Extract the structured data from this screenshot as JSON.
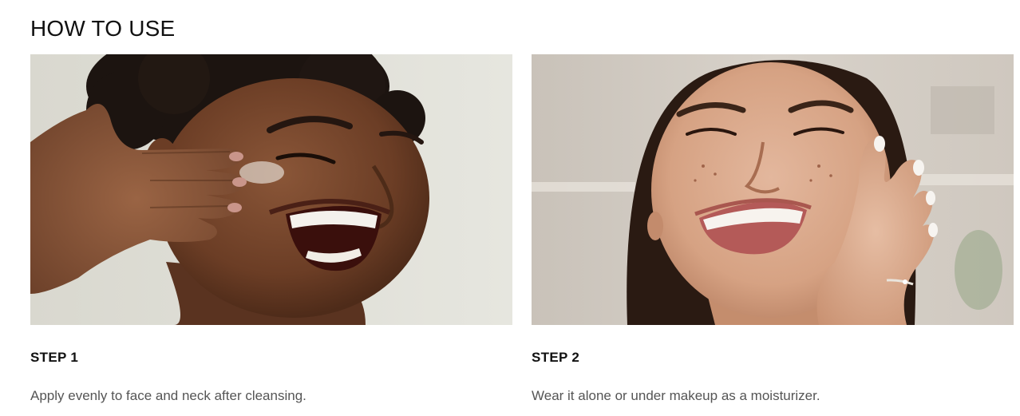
{
  "section": {
    "title": "HOW TO USE"
  },
  "steps": [
    {
      "label": "STEP 1",
      "text": "Apply evenly to face and neck after cleansing.",
      "image": "woman-applying-cream-to-cheek"
    },
    {
      "label": "STEP 2",
      "text": "Wear it alone or under makeup as a moisturizer.",
      "image": "woman-smiling-hand-on-cheek"
    }
  ],
  "colors": {
    "heading": "#111111",
    "body_text": "#555555",
    "background": "#ffffff"
  }
}
